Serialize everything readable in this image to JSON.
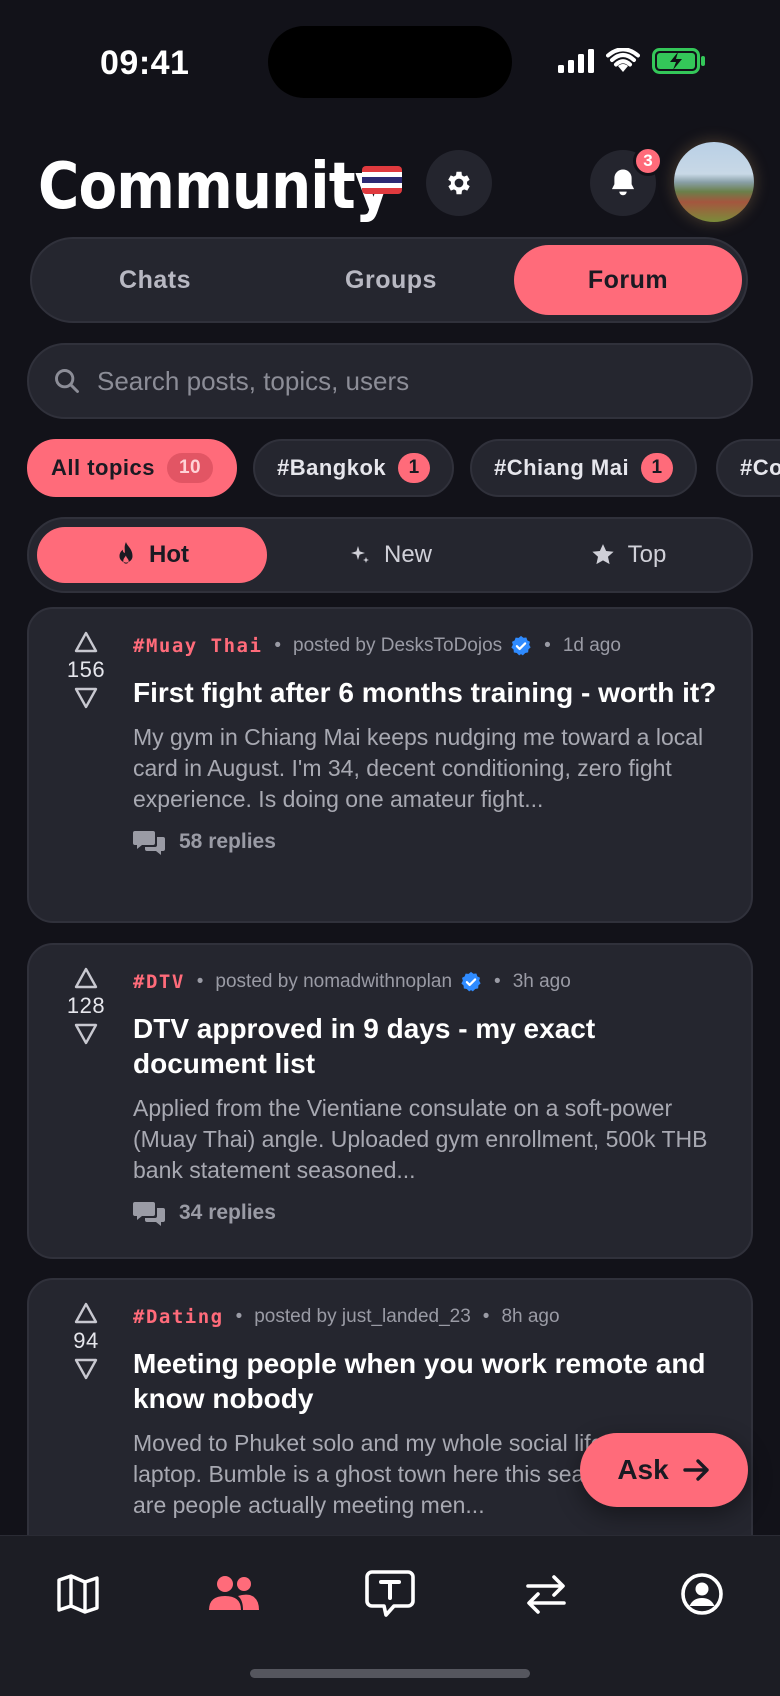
{
  "status": {
    "time": "09:41"
  },
  "header": {
    "title": "Community",
    "notification_count": "3",
    "colors": {
      "accent": "#ff6b7a",
      "background": "#121219",
      "card": "#25262f"
    }
  },
  "tabs": [
    {
      "label": "Chats"
    },
    {
      "label": "Groups"
    },
    {
      "label": "Forum",
      "active": true
    }
  ],
  "search": {
    "placeholder": "Search posts, topics, users"
  },
  "topics": [
    {
      "label": "All topics",
      "count": "10",
      "active": true
    },
    {
      "label": "#Bangkok",
      "count": "1"
    },
    {
      "label": "#Chiang Mai",
      "count": "1"
    },
    {
      "label": "#Co",
      "count": ""
    }
  ],
  "sort": [
    {
      "label": "Hot",
      "icon": "flame-icon",
      "active": true
    },
    {
      "label": "New",
      "icon": "sparkle-icon"
    },
    {
      "label": "Top",
      "icon": "star-icon"
    }
  ],
  "posts": [
    {
      "votes": "156",
      "tag": "#Muay Thai",
      "posted_by": "posted by DesksToDojos",
      "verified": true,
      "time": "1d ago",
      "title": "First fight after 6 months training - worth it?",
      "excerpt": "My gym in Chiang Mai keeps nudging me toward a local card in August. I'm 34, decent conditioning, zero fight experience. Is doing one amateur fight...",
      "replies": "58 replies"
    },
    {
      "votes": "128",
      "tag": "#DTV",
      "posted_by": "posted by nomadwithnoplan",
      "verified": true,
      "time": "3h ago",
      "title": "DTV approved in 9 days - my exact document list",
      "excerpt": "Applied from the Vientiane consulate on a soft-power (Muay Thai) angle. Uploaded gym enrollment, 500k THB bank statement seasoned...",
      "replies": "34 replies"
    },
    {
      "votes": "94",
      "tag": "#Dating",
      "posted_by": "posted by just_landed_23",
      "verified": false,
      "time": "8h ago",
      "title": "Meeting people when you work remote and know nobody",
      "excerpt": "Moved to Phuket solo and my whole social life is my laptop. Bumble is a ghost town here this season. Where are people actually meeting men...",
      "replies": ""
    }
  ],
  "fab": {
    "label": "Ask"
  },
  "nav": [
    {
      "icon": "map-icon"
    },
    {
      "icon": "community-icon",
      "active": true
    },
    {
      "icon": "chat-topic-icon"
    },
    {
      "icon": "exchange-icon"
    },
    {
      "icon": "profile-icon"
    }
  ]
}
